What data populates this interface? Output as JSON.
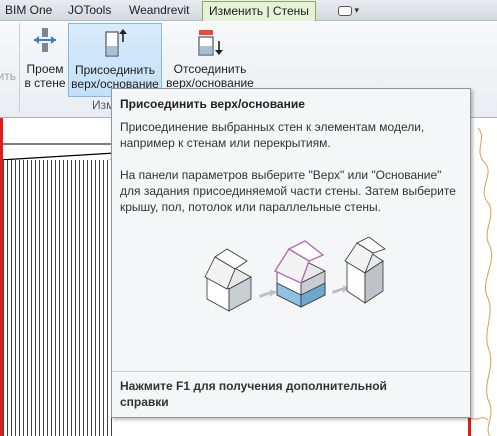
{
  "tabs": [
    {
      "label": "BIM One"
    },
    {
      "label": "JOTools"
    },
    {
      "label": "Weandrevit"
    },
    {
      "label": "Изменить | Стены",
      "active": true
    }
  ],
  "ribbon": {
    "partial_button_label": "ить",
    "wall_opening_label": "Проем\nв стене",
    "attach_label": "Присоединить\nверх/основание",
    "detach_label": "Отсоединить\nверх/основание",
    "group_label": "Изм"
  },
  "tooltip": {
    "title": "Присоединить верх/основание",
    "paragraph1": "Присоединение выбранных стен к элементам модели, например к стенам или перекрытиям.",
    "paragraph2": "На панели параметров выберите \"Верх\" или \"Основание\" для задания присоединяемой части стены. Затем выберите крышу, пол, потолок или параллельные стены.",
    "footer": "Нажмите F1 для получения дополнительной справки"
  },
  "colors": {
    "active_tab_bg": "#e6f1d7",
    "active_tab_border": "#86ad5a",
    "highlight_button_bg": "#c3e0f7",
    "red_boundary": "#e21b1b"
  },
  "icons": [
    "wall-opening-icon",
    "attach-top-base-icon",
    "detach-top-base-icon",
    "ribbon-minimize-icon"
  ]
}
